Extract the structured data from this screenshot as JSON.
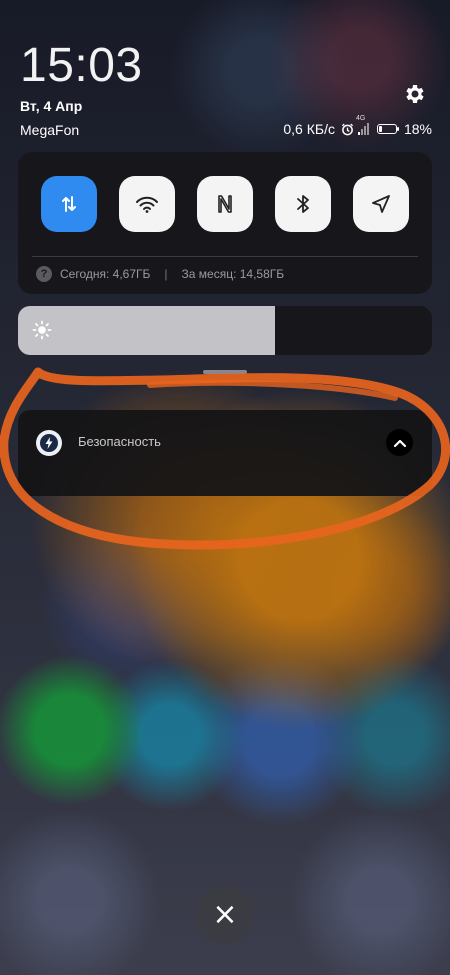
{
  "status": {
    "time": "15:03",
    "date": "Вт, 4 Апр",
    "carrier": "MegaFon",
    "speed": "0,6 КБ/с",
    "network": "4G",
    "battery": "18%",
    "battery_level": 0.18
  },
  "toggles": [
    {
      "name": "mobile-data",
      "icon": "data-transfer-icon",
      "active": true
    },
    {
      "name": "wifi",
      "icon": "wifi-icon",
      "active": false
    },
    {
      "name": "nfc",
      "icon": "nfc-icon",
      "active": false
    },
    {
      "name": "bluetooth",
      "icon": "bluetooth-icon",
      "active": false
    },
    {
      "name": "location",
      "icon": "location-icon",
      "active": false
    }
  ],
  "usage": {
    "today": "Сегодня: 4,67ГБ",
    "separator": "|",
    "month": "За месяц: 14,58ГБ"
  },
  "brightness": {
    "level": 0.62,
    "icon": "sun-icon"
  },
  "notification": {
    "app": "Безопасность",
    "icon": "security-bolt-icon"
  },
  "close": {
    "label": "×"
  },
  "colors": {
    "accent": "#2f8bf0",
    "panel": "#16161a",
    "annotation": "#e8641e"
  }
}
